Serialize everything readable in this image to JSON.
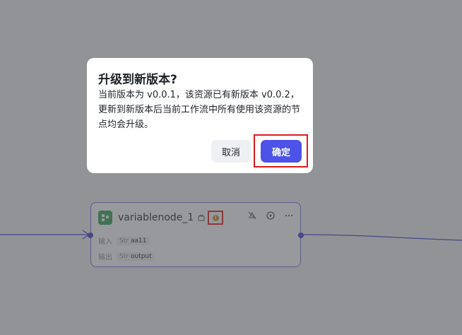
{
  "dialog": {
    "title": "升级到新版本?",
    "message": "当前版本为 v0.0.1，该资源已有新版本 v0.0.2，更新到新版本后当前工作流中所有使用该资源的节点均会升级。",
    "cancel_label": "取消",
    "confirm_label": "确定"
  },
  "node": {
    "title": "variablenode_1",
    "input_label": "输入",
    "input_type": "Str",
    "input_value": "aa11",
    "output_label": "输出",
    "output_type": "Str",
    "output_value": "output",
    "icon": "variable-node-icon",
    "warning_icon": "warning-icon"
  },
  "colors": {
    "accent": "#4d53e8",
    "edge": "#3c3fd0",
    "node_icon_bg": "#2fa44f",
    "warning": "#d2891a",
    "highlight": "#e01a1a",
    "overlay": "#4e4f54"
  }
}
